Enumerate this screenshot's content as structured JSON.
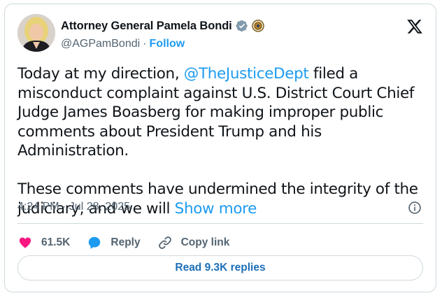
{
  "author": {
    "display_name": "Attorney General Pamela Bondi",
    "handle": "@AGPamBondi",
    "separator": "·",
    "follow_label": "Follow"
  },
  "tweet": {
    "p1_before": "Today at my direction, ",
    "mention": "@TheJusticeDept",
    "p1_after": " filed a misconduct complaint against U.S. District Court Chief Judge James Boasberg for making improper public comments about President Trump and his Administration.",
    "p2_text": "These comments have undermined the integrity of the judiciary, and we will ",
    "show_more": "Show more",
    "timestamp": "4:24 PM · Jul 28, 2025"
  },
  "actions": {
    "likes": "61.5K",
    "reply_label": "Reply",
    "copy_link_label": "Copy link",
    "read_replies_label": "Read 9.3K replies"
  },
  "colors": {
    "accent": "#1d9bf0",
    "like": "#f91880",
    "verified": "#829aab"
  },
  "icons": [
    "verified-badge-icon",
    "doj-seal-icon",
    "x-logo-icon",
    "info-icon",
    "heart-icon",
    "reply-bubble-icon",
    "link-icon"
  ]
}
